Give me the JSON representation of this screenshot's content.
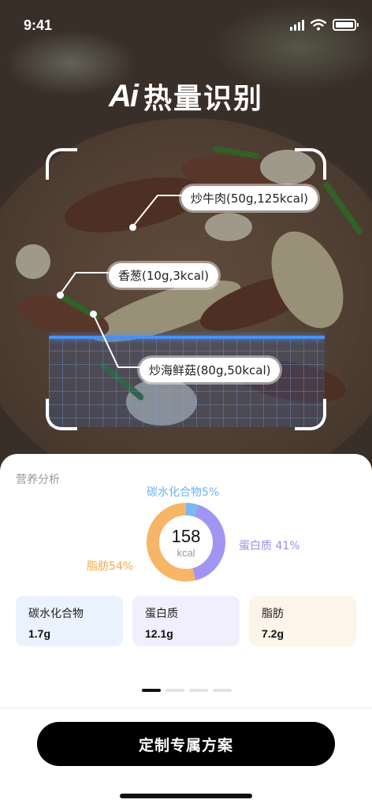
{
  "status_bar": {
    "time": "9:41"
  },
  "header": {
    "logo": "Ai",
    "title": "热量识别"
  },
  "food_tags": [
    {
      "label": "炒牛肉(50g,125kcal)"
    },
    {
      "label": "香葱(10g,3kcal)"
    },
    {
      "label": "炒海鲜菇(80g,50kcal)"
    }
  ],
  "nutrition": {
    "section_label": "营养分析",
    "total_kcal": "158",
    "kcal_unit": "kcal",
    "breakdown": [
      {
        "label": "碳水化合物5%",
        "percent": 5,
        "color": "#7ab8ee"
      },
      {
        "label": "蛋白质 41%",
        "percent": 41,
        "color": "#a195f4"
      },
      {
        "label": "脂肪54%",
        "percent": 54,
        "color": "#f7b567"
      }
    ],
    "cards": [
      {
        "name": "碳水化合物",
        "value": "1.7g"
      },
      {
        "name": "蛋白质",
        "value": "12.1g"
      },
      {
        "name": "脂肪",
        "value": "7.2g"
      }
    ]
  },
  "pager": {
    "pages": 4,
    "active": 0
  },
  "cta": {
    "label": "定制专属方案"
  }
}
